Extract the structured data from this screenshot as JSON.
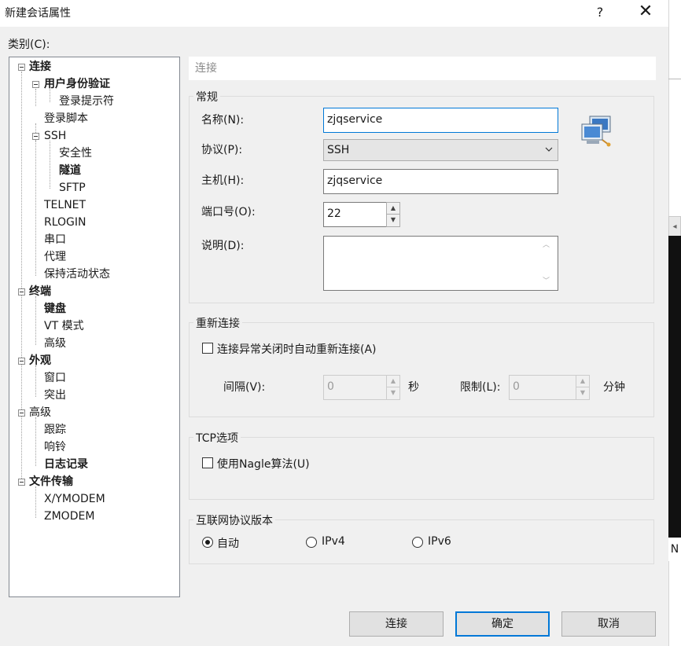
{
  "window": {
    "title": "新建会话属性",
    "help": "?",
    "close": "✕"
  },
  "category_label": "类别(C):",
  "tree": [
    {
      "label": "连接",
      "bold": true
    },
    {
      "label": "用户身份验证",
      "bold": true
    },
    {
      "label": "登录提示符",
      "bold": false
    },
    {
      "label": "登录脚本",
      "bold": false
    },
    {
      "label": "SSH",
      "bold": false
    },
    {
      "label": "安全性",
      "bold": false
    },
    {
      "label": "隧道",
      "bold": true
    },
    {
      "label": "SFTP",
      "bold": false
    },
    {
      "label": "TELNET",
      "bold": false
    },
    {
      "label": "RLOGIN",
      "bold": false
    },
    {
      "label": "串口",
      "bold": false
    },
    {
      "label": "代理",
      "bold": false
    },
    {
      "label": "保持活动状态",
      "bold": false
    },
    {
      "label": "终端",
      "bold": true
    },
    {
      "label": "键盘",
      "bold": true
    },
    {
      "label": "VT 模式",
      "bold": false
    },
    {
      "label": "高级",
      "bold": false
    },
    {
      "label": "外观",
      "bold": true
    },
    {
      "label": "窗口",
      "bold": false
    },
    {
      "label": "突出",
      "bold": false
    },
    {
      "label": "高级",
      "bold": false
    },
    {
      "label": "跟踪",
      "bold": false
    },
    {
      "label": "响铃",
      "bold": false
    },
    {
      "label": "日志记录",
      "bold": true
    },
    {
      "label": "文件传输",
      "bold": true
    },
    {
      "label": "X/YMODEM",
      "bold": false
    },
    {
      "label": "ZMODEM",
      "bold": false
    }
  ],
  "section_header": "连接",
  "general": {
    "title": "常规",
    "name_label": "名称(N):",
    "name_value": "zjqservice",
    "protocol_label": "协议(P):",
    "protocol_value": "SSH",
    "host_label": "主机(H):",
    "host_value": "zjqservice",
    "port_label": "端口号(O):",
    "port_value": "22",
    "desc_label": "说明(D):",
    "desc_value": ""
  },
  "reconnect": {
    "title": "重新连接",
    "checkbox_label": "连接异常关闭时自动重新连接(A)",
    "interval_label": "间隔(V):",
    "interval_value": "0",
    "interval_unit": "秒",
    "limit_label": "限制(L):",
    "limit_value": "0",
    "limit_unit": "分钟"
  },
  "tcp": {
    "title": "TCP选项",
    "nagle_label": "使用Nagle算法(U)"
  },
  "ip_version": {
    "title": "互联网协议版本",
    "options": [
      "自动",
      "IPv4",
      "IPv6"
    ],
    "selected": "自动"
  },
  "buttons": {
    "connect": "连接",
    "ok": "确定",
    "cancel": "取消"
  },
  "background_window": {
    "letter": "N"
  }
}
